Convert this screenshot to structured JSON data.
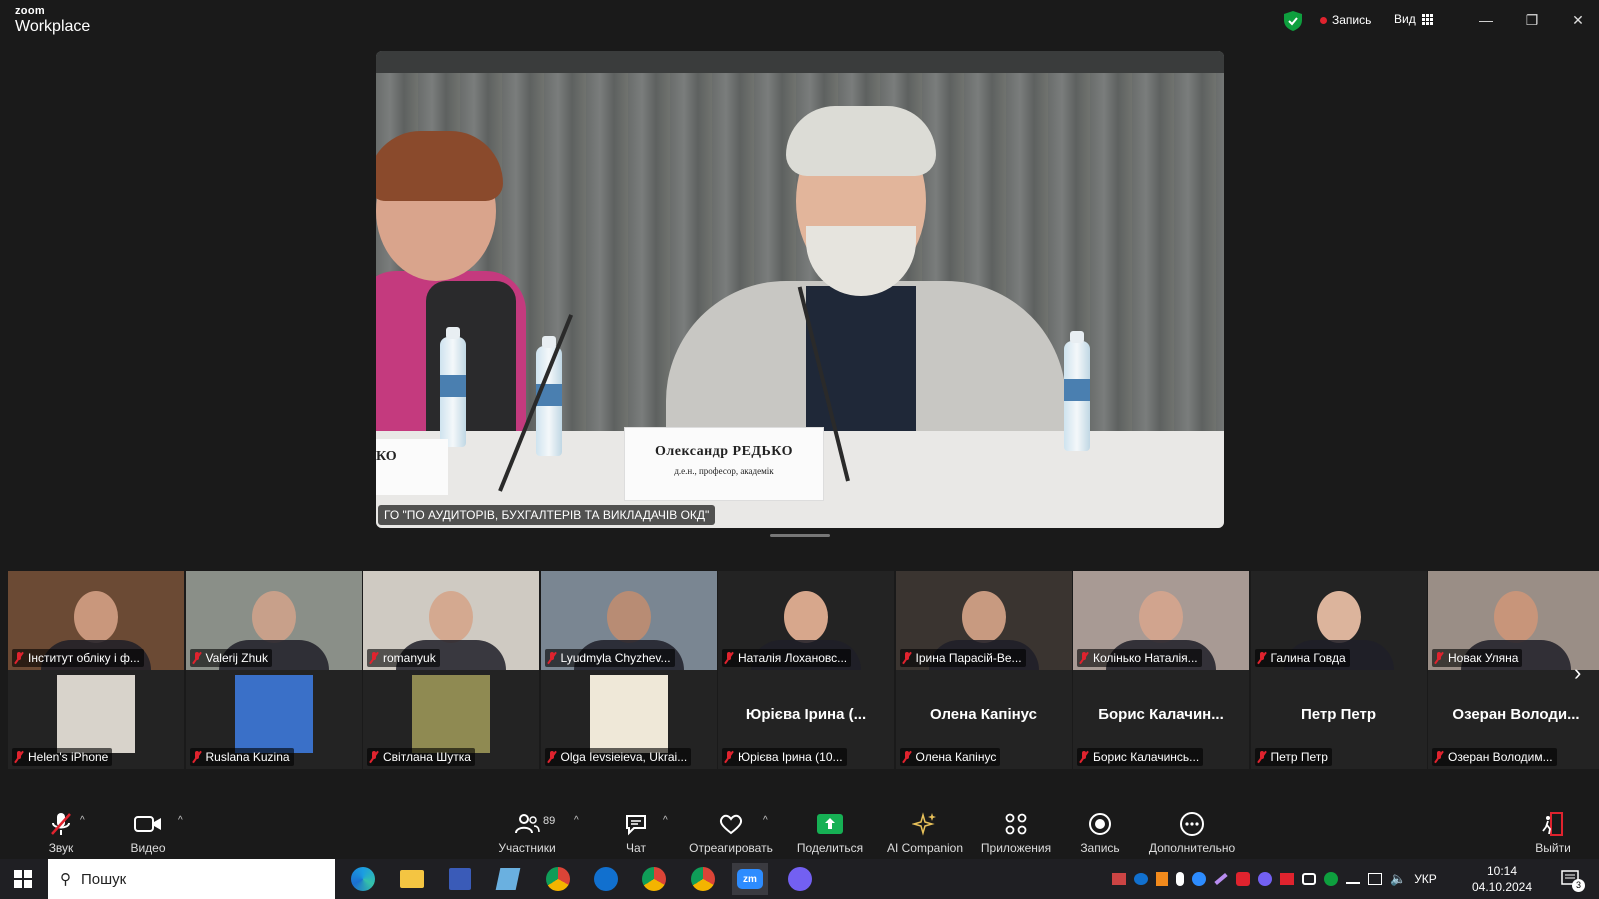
{
  "window": {
    "app_brand_top": "zoom",
    "app_brand_bottom": "Workplace",
    "recording_label": "Запись",
    "view_label": "Вид"
  },
  "main_video": {
    "caption": "ГО \"ПО АУДИТОРІВ, БУХГАЛТЕРІВ ТА ВИКЛАДАЧІВ ОКД\"",
    "nameplate_name": "Олександр РЕДЬКО",
    "nameplate_subtitle": "д.е.н., професор, академік",
    "nameplate_left_partial": "КО"
  },
  "gallery": {
    "row1": [
      {
        "name": "Інститут обліку і ф...",
        "bg": "#6b4a34",
        "face": "#c9977c"
      },
      {
        "name": "Valerij Zhuk",
        "bg": "#8a8f88",
        "face": "#c8a08a"
      },
      {
        "name": "romanyuk",
        "bg": "#cfcac2",
        "face": "#d4a990"
      },
      {
        "name": "Lyudmyla Chyzhev...",
        "bg": "#7a8692",
        "face": "#b88c74"
      },
      {
        "name": "Наталія Лохановс...",
        "bg": "#232323",
        "face": "#d7a78c"
      },
      {
        "name": "Ірина Парасій-Ве...",
        "bg": "#3a3430",
        "face": "#c89a80"
      },
      {
        "name": "Колінько Наталія...",
        "bg": "#a89a94",
        "face": "#d1a48e"
      },
      {
        "name": "Галина Говда",
        "bg": "#232323",
        "face": "#dcb49c"
      },
      {
        "name": "Новак Уляна",
        "bg": "#9a8e86",
        "face": "#c8957a"
      }
    ],
    "row2": [
      {
        "name": "Helen's iPhone",
        "big": "",
        "bg": "#232323"
      },
      {
        "name": "Ruslana Kuzina",
        "big": "",
        "bg": "#232323"
      },
      {
        "name": "Світлана Шутка",
        "big": "",
        "bg": "#232323"
      },
      {
        "name": "Olga Ievsieieva, Ukrai...",
        "big": "",
        "bg": "#232323"
      },
      {
        "name": "Юрієва Ірина (10...",
        "big": "Юрієва Ірина (...",
        "bg": "#232323"
      },
      {
        "name": "Олена Капінус",
        "big": "Олена Капінус",
        "bg": "#232323"
      },
      {
        "name": "Борис Калачинсь...",
        "big": "Борис Калачин...",
        "bg": "#232323"
      },
      {
        "name": "Петр Петр",
        "big": "Петр Петр",
        "bg": "#232323"
      },
      {
        "name": "Озеран Володим...",
        "big": "Озеран Володи...",
        "bg": "#232323"
      }
    ]
  },
  "toolbar": {
    "audio": "Звук",
    "video": "Видео",
    "participants": "Участники",
    "participants_count": "89",
    "chat": "Чат",
    "react": "Отреагировать",
    "share": "Поделиться",
    "ai": "AI Companion",
    "apps": "Приложения",
    "record": "Запись",
    "more": "Дополнительно",
    "leave": "Выйти"
  },
  "taskbar": {
    "search_placeholder": "Пошук",
    "language": "УКР",
    "time": "10:14",
    "date": "04.10.2024",
    "notifications": "3"
  },
  "colors": {
    "accent_green": "#0e9f3e",
    "record_red": "#e0232e",
    "share_green": "#16b054"
  }
}
